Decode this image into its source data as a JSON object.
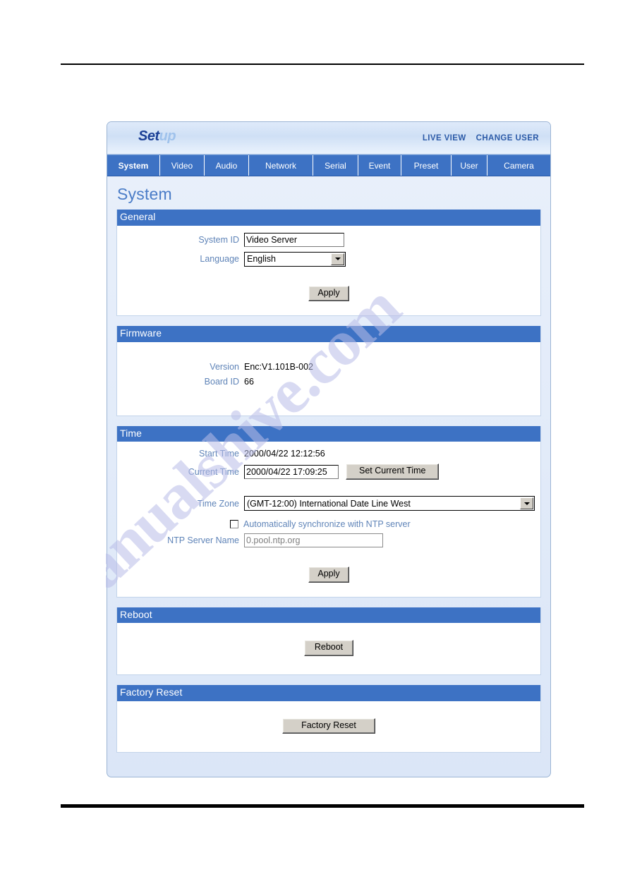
{
  "header": {
    "logo_bold": "Set",
    "logo_light": "up",
    "live_view": "LIVE VIEW",
    "change_user": "CHANGE USER"
  },
  "tabs": [
    {
      "label": "System",
      "active": true
    },
    {
      "label": "Video",
      "active": false
    },
    {
      "label": "Audio",
      "active": false
    },
    {
      "label": "Network",
      "active": false
    },
    {
      "label": "Serial",
      "active": false
    },
    {
      "label": "Event",
      "active": false
    },
    {
      "label": "Preset",
      "active": false
    },
    {
      "label": "User",
      "active": false
    },
    {
      "label": "Camera",
      "active": false
    }
  ],
  "page": {
    "title": "System"
  },
  "general": {
    "section_title": "General",
    "system_id_label": "System ID",
    "system_id_value": "Video Server",
    "language_label": "Language",
    "language_value": "English",
    "apply_label": "Apply"
  },
  "firmware": {
    "section_title": "Firmware",
    "version_label": "Version",
    "version_value": "Enc:V1.101B-002",
    "board_id_label": "Board ID",
    "board_id_value": "66"
  },
  "time": {
    "section_title": "Time",
    "start_time_label": "Start Time",
    "start_time_value": "2000/04/22 12:12:56",
    "current_time_label": "Current Time",
    "current_time_value": "2000/04/22 17:09:25",
    "set_current_time_label": "Set Current Time",
    "time_zone_label": "Time Zone",
    "time_zone_value": "(GMT-12:00) International Date Line West",
    "ntp_checkbox_label": "Automatically synchronize with NTP server",
    "ntp_checked": false,
    "ntp_server_label": "NTP Server Name",
    "ntp_server_value": "0.pool.ntp.org",
    "apply_label": "Apply"
  },
  "reboot": {
    "section_title": "Reboot",
    "button_label": "Reboot"
  },
  "factory_reset": {
    "section_title": "Factory Reset",
    "button_label": "Factory Reset"
  },
  "watermark": {
    "text": "manualshive.com"
  },
  "colors": {
    "accent_blue": "#3d72c4",
    "label_blue": "#5f84b8",
    "title_blue": "#4a7cc7",
    "page_bg": "#dbe6f7"
  }
}
